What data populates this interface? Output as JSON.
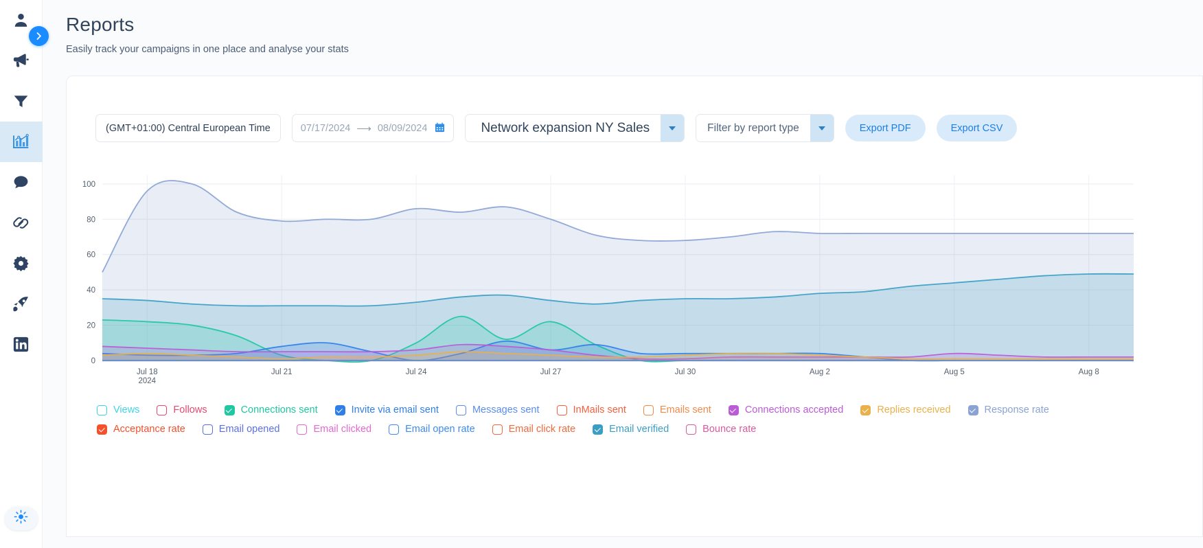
{
  "rail": {
    "collapse_icon": "chevron-right-icon",
    "items": [
      {
        "name": "person-icon",
        "label": "Leads"
      },
      {
        "name": "megaphone-icon",
        "label": "Campaigns"
      },
      {
        "name": "funnel-icon",
        "label": "Filters"
      },
      {
        "name": "bar-chart-icon",
        "label": "Reports",
        "active": true
      },
      {
        "name": "chat-bubble-icon",
        "label": "Inbox"
      },
      {
        "name": "link-icon",
        "label": "Integrations"
      },
      {
        "name": "gear-icon",
        "label": "Settings"
      },
      {
        "name": "rocket-icon",
        "label": "Boost"
      },
      {
        "name": "linkedin-icon",
        "label": "LinkedIn"
      }
    ],
    "bottom_icon": "sun-brightness-icon"
  },
  "header": {
    "title": "Reports",
    "subtitle": "Easily track your campaigns in one place and analyse your stats"
  },
  "toolbar": {
    "timezone": "(GMT+01:00) Central European Time",
    "date_from": "07/17/2024",
    "date_arrow": "⟶",
    "date_to": "08/09/2024",
    "calendar_icon": "calendar-icon",
    "campaign_select": "Network expansion NY Sales",
    "report_type_select": "Filter by report type",
    "export_pdf": "Export PDF",
    "export_csv": "Export CSV"
  },
  "chart_data": {
    "type": "area",
    "title": "",
    "xlabel": "",
    "ylabel": "",
    "ylim": [
      0,
      105
    ],
    "yticks": [
      0,
      20,
      40,
      60,
      80,
      100
    ],
    "grid": true,
    "legend_position": "bottom",
    "x": [
      "Jul 17",
      "Jul 18",
      "Jul 19",
      "Jul 20",
      "Jul 21",
      "Jul 22",
      "Jul 23",
      "Jul 24",
      "Jul 25",
      "Jul 26",
      "Jul 27",
      "Jul 28",
      "Jul 29",
      "Jul 30",
      "Jul 31",
      "Aug 1",
      "Aug 2",
      "Aug 3",
      "Aug 4",
      "Aug 5",
      "Aug 6",
      "Aug 7",
      "Aug 8",
      "Aug 9"
    ],
    "xticks": [
      "Jul 18",
      "Jul 21",
      "Jul 24",
      "Jul 27",
      "Jul 30",
      "Aug 2",
      "Aug 5",
      "Aug 8"
    ],
    "xtick_sub": "2024",
    "series": [
      {
        "name": "Views",
        "color": "#3ed4e8",
        "visible": false,
        "values": [
          0,
          0,
          0,
          0,
          0,
          0,
          0,
          0,
          0,
          0,
          0,
          0,
          0,
          0,
          0,
          0,
          0,
          0,
          0,
          0,
          0,
          0,
          0,
          0
        ]
      },
      {
        "name": "Follows",
        "color": "#e8486f",
        "visible": false,
        "values": [
          0,
          0,
          0,
          0,
          0,
          0,
          0,
          0,
          0,
          0,
          0,
          0,
          0,
          0,
          0,
          0,
          0,
          0,
          0,
          0,
          0,
          0,
          0,
          0
        ]
      },
      {
        "name": "Connections sent",
        "color": "#1fc8a0",
        "visible": true,
        "values": [
          23,
          22,
          20,
          14,
          3,
          0,
          0,
          10,
          25,
          12,
          22,
          9,
          0,
          0,
          0,
          0,
          0,
          0,
          0,
          0,
          0,
          0,
          0,
          0
        ]
      },
      {
        "name": "Invite via email sent",
        "color": "#2f7fe8",
        "visible": true,
        "values": [
          4,
          3,
          3,
          4,
          8,
          10,
          5,
          0,
          4,
          11,
          6,
          9,
          4,
          4,
          4,
          4,
          4,
          2,
          0,
          0,
          0,
          0,
          0,
          0
        ]
      },
      {
        "name": "Messages sent",
        "color": "#5b8def",
        "visible": false,
        "values": [
          0,
          0,
          0,
          0,
          0,
          0,
          0,
          0,
          0,
          0,
          0,
          0,
          0,
          0,
          0,
          0,
          0,
          0,
          0,
          0,
          0,
          0,
          0,
          0
        ]
      },
      {
        "name": "InMails sent",
        "color": "#f4603c",
        "visible": false,
        "values": [
          0,
          0,
          0,
          0,
          0,
          0,
          0,
          0,
          0,
          0,
          0,
          0,
          0,
          0,
          0,
          0,
          0,
          0,
          0,
          0,
          0,
          0,
          0,
          0
        ]
      },
      {
        "name": "Emails sent",
        "color": "#f08a4b",
        "visible": false,
        "values": [
          0,
          0,
          0,
          0,
          0,
          0,
          0,
          0,
          0,
          0,
          0,
          0,
          0,
          0,
          0,
          0,
          0,
          0,
          0,
          0,
          0,
          0,
          0,
          0
        ]
      },
      {
        "name": "Connections accepted",
        "color": "#bb5bd6",
        "visible": true,
        "values": [
          8,
          7,
          6,
          5,
          5,
          5,
          5,
          6,
          9,
          8,
          6,
          3,
          1,
          1,
          2,
          2,
          2,
          2,
          2,
          4,
          3,
          2,
          2,
          2
        ]
      },
      {
        "name": "Replies received",
        "color": "#eab04a",
        "visible": true,
        "values": [
          3,
          4,
          3,
          2,
          1,
          2,
          2,
          3,
          5,
          4,
          3,
          2,
          2,
          3,
          4,
          4,
          3,
          2,
          1,
          1,
          1,
          1,
          1,
          1
        ]
      },
      {
        "name": "Response rate",
        "color": "#8aa3d4",
        "visible": true,
        "values": [
          50,
          96,
          100,
          84,
          79,
          80,
          80,
          86,
          84,
          87,
          80,
          71,
          68,
          68,
          70,
          73,
          72,
          72,
          72,
          72,
          72,
          72,
          72,
          72
        ]
      },
      {
        "name": "Acceptance rate",
        "color": "#f4502b",
        "visible": true,
        "values": [
          0,
          0,
          0,
          0,
          0,
          0,
          0,
          0,
          0,
          0,
          0,
          0,
          0,
          0,
          0,
          0,
          0,
          0,
          0,
          0,
          0,
          0,
          0,
          0
        ]
      },
      {
        "name": "Email opened",
        "color": "#5b6fe8",
        "visible": false,
        "values": [
          0,
          0,
          0,
          0,
          0,
          0,
          0,
          0,
          0,
          0,
          0,
          0,
          0,
          0,
          0,
          0,
          0,
          0,
          0,
          0,
          0,
          0,
          0,
          0
        ]
      },
      {
        "name": "Email clicked",
        "color": "#e26ad0",
        "visible": false,
        "values": [
          0,
          0,
          0,
          0,
          0,
          0,
          0,
          0,
          0,
          0,
          0,
          0,
          0,
          0,
          0,
          0,
          0,
          0,
          0,
          0,
          0,
          0,
          0,
          0
        ]
      },
      {
        "name": "Email open rate",
        "color": "#3d8bf2",
        "visible": false,
        "values": [
          0,
          0,
          0,
          0,
          0,
          0,
          0,
          0,
          0,
          0,
          0,
          0,
          0,
          0,
          0,
          0,
          0,
          0,
          0,
          0,
          0,
          0,
          0,
          0
        ]
      },
      {
        "name": "Email click rate",
        "color": "#f06a3c",
        "visible": false,
        "values": [
          0,
          0,
          0,
          0,
          0,
          0,
          0,
          0,
          0,
          0,
          0,
          0,
          0,
          0,
          0,
          0,
          0,
          0,
          0,
          0,
          0,
          0,
          0,
          0
        ]
      },
      {
        "name": "Email verified",
        "color": "#3a9ec4",
        "visible": true,
        "values": [
          35,
          34,
          32,
          31,
          31,
          31,
          31,
          33,
          36,
          37,
          34,
          32,
          34,
          35,
          35,
          36,
          38,
          39,
          42,
          44,
          46,
          48,
          49,
          49
        ]
      },
      {
        "name": "Bounce rate",
        "color": "#d95a9e",
        "visible": false,
        "values": [
          0,
          0,
          0,
          0,
          0,
          0,
          0,
          0,
          0,
          0,
          0,
          0,
          0,
          0,
          0,
          0,
          0,
          0,
          0,
          0,
          0,
          0,
          0,
          0
        ]
      }
    ]
  },
  "legend": {
    "row1": [
      "Views",
      "Follows",
      "Connections sent",
      "Invite via email sent",
      "Messages sent",
      "InMails sent",
      "Emails sent",
      "Connections accepted",
      "Replies received",
      "Response rate"
    ],
    "row2": [
      "Acceptance rate",
      "Email opened",
      "Email clicked",
      "Email open rate",
      "Email click rate",
      "Email verified",
      "Bounce rate"
    ]
  }
}
